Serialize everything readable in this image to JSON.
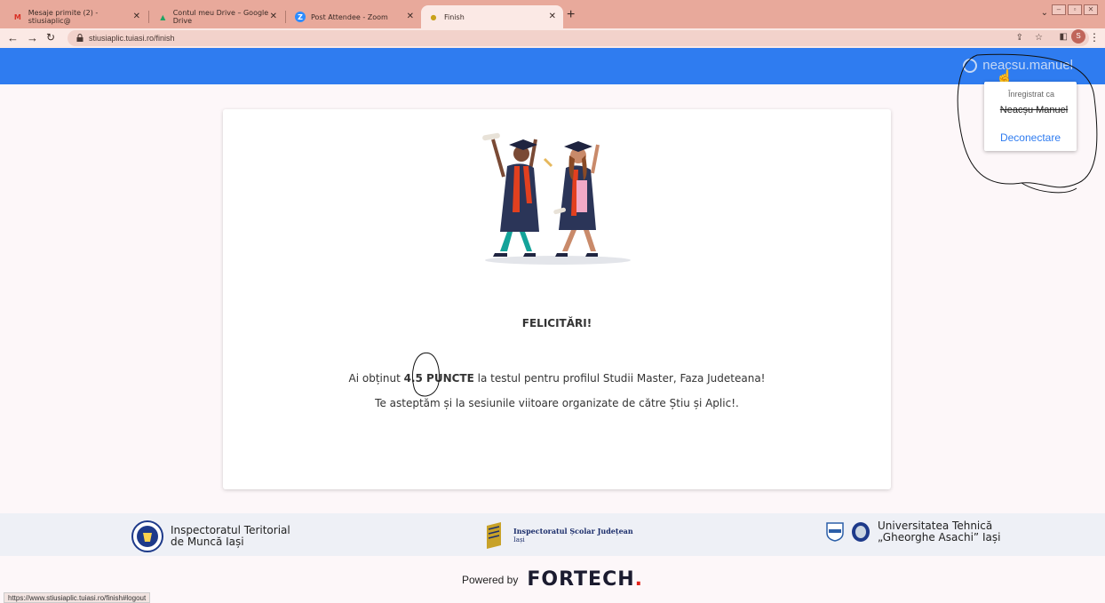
{
  "browser": {
    "tabs": [
      {
        "title": "Mesaje primite (2) - stiusiaplic@",
        "favicon": "gmail-icon",
        "favicon_char": "M",
        "favicon_color": "#d93025"
      },
      {
        "title": "Contul meu Drive – Google Drive",
        "favicon": "drive-icon",
        "favicon_char": "▲",
        "favicon_color": "#1fa463"
      },
      {
        "title": "Post Attendee - Zoom",
        "favicon": "zoom-icon",
        "favicon_char": "Z",
        "favicon_color": "#2d8cff"
      },
      {
        "title": "Finish",
        "favicon": "graduation-icon",
        "favicon_char": "●",
        "favicon_color": "#c9a21b",
        "active": true
      }
    ],
    "url": "stiusiaplic.tuiasi.ro/finish",
    "profile_initial": "S",
    "status_url": "https://www.stiusiaplic.tuiasi.ro/finish#logout"
  },
  "header": {
    "username": "neacsu.manuel",
    "menu": {
      "registered_as_label": "Înregistrat ca",
      "registered_name": "Neacșu Manuel",
      "logout_label": "Deconectare"
    }
  },
  "card": {
    "title": "FELICITĂRI!",
    "result_prefix": "Ai obținut ",
    "points_value": "4.5",
    "points_label": "PUNCTE",
    "result_suffix": " la testul pentru profilul Studii Master, Faza Judeteana!",
    "wait_message": "Te asteptăm și la sesiunile viitoare organizate de către Știu și Aplic!."
  },
  "footer": {
    "partners": [
      {
        "line1": "Inspectoratul Teritorial",
        "line2": "de Muncă Iași"
      },
      {
        "line1": "Inspectoratul Școlar Județean",
        "line2": "Iași"
      },
      {
        "line1": "Universitatea Tehnică",
        "line2": "„Gheorghe Asachi” Iași"
      }
    ],
    "powered_by": "Powered by",
    "brand": "FORTECH",
    "brand_dot": "."
  },
  "colors": {
    "appbar": "#2f7cf0",
    "tabbar": "#e8a99b",
    "link": "#2f7cf0",
    "brand_dot": "#e2231a"
  }
}
